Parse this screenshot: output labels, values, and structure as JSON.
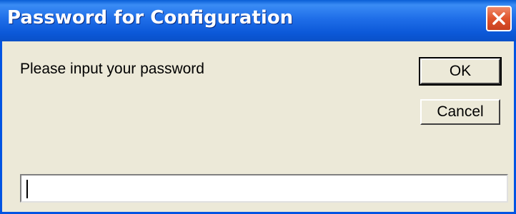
{
  "dialog": {
    "title": "Password for Configuration",
    "prompt": "Please input your password",
    "ok_label": "OK",
    "cancel_label": "Cancel",
    "password_value": "",
    "close_icon": "close-icon"
  },
  "colors": {
    "titlebar": "#0b58d8",
    "window_bg": "#ece9d8",
    "close_button": "#e0542c"
  }
}
